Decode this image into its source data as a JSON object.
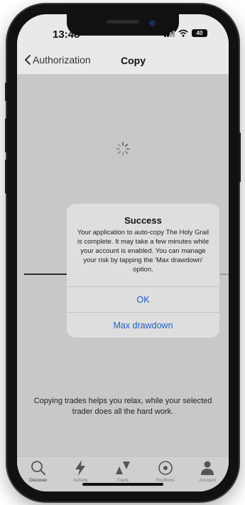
{
  "status_bar": {
    "time": "13:48",
    "battery": "40"
  },
  "nav": {
    "back_label": "Authorization",
    "title": "Copy"
  },
  "dialog": {
    "title": "Success",
    "message": "Your application to auto-copy The Holy Grail is complete. It may take a few minutes while your account is enabled. You can manage your risk by tapping the 'Max drawdown' option.",
    "ok_label": "OK",
    "max_drawdown_label": "Max drawdown"
  },
  "info_text": "Copying trades helps you relax, while your selected trader does all the hard work.",
  "tabs": [
    {
      "label": "Discover",
      "icon": "search-icon",
      "active": true
    },
    {
      "label": "Activity",
      "icon": "lightning-icon",
      "active": false
    },
    {
      "label": "Trade",
      "icon": "trade-arrows-icon",
      "active": false
    },
    {
      "label": "Positions",
      "icon": "target-icon",
      "active": false
    },
    {
      "label": "Account",
      "icon": "person-icon",
      "active": false
    }
  ]
}
